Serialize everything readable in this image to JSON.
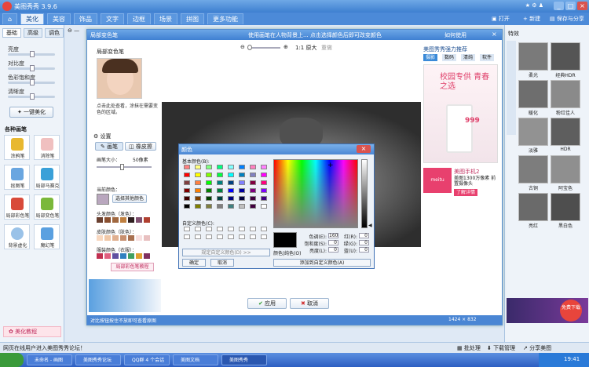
{
  "app": {
    "title": "美图秀秀 3.9.6",
    "open_label": "打开",
    "new_label": "新建",
    "save_label": "保存与分享"
  },
  "tabs": [
    {
      "label": "美化"
    },
    {
      "label": "美容"
    },
    {
      "label": "饰品"
    },
    {
      "label": "文字"
    },
    {
      "label": "边框"
    },
    {
      "label": "场景"
    },
    {
      "label": "拼图"
    },
    {
      "label": "更多功能"
    }
  ],
  "left": {
    "subtabs": [
      "基础",
      "高级",
      "调色"
    ],
    "sliders": [
      "亮度",
      "对比度",
      "色彩饱和度",
      "清晰度"
    ],
    "one_click": "一键美化",
    "section_title": "各种画笔",
    "tools": [
      "涂鸦笔",
      "消除笔",
      "抠图笔",
      "局部马赛克",
      "局部彩色笔",
      "局部变色笔",
      "背景虚化",
      "魔幻笔"
    ],
    "bottom_label": "美化教程"
  },
  "editor": {
    "title": "局部变色笔",
    "header_center": "使用画笔在人物背景上... 点击选择颜色后即可改变颜色",
    "header_right": "如何使用",
    "zoom_label": "1:1 原大",
    "reset_label": "重做",
    "sample_caption": "局部变色笔",
    "instructions": "点击此处查看，涂抹在需要变色的区域。",
    "settings_title": "设置",
    "mode_paint": "画笔",
    "mode_erase": "橡皮擦",
    "brush_size_label": "画笔大小：",
    "brush_size_value": "50像素",
    "current_color_label": "当前颜色：",
    "choose_color_btn": "选择其他颜色",
    "hair_label": "头发颜色（发色）：",
    "skin_label": "皮肤颜色（肤色）：",
    "clothes_label": "服装颜色（衣服）：",
    "tutorial_btn": "局部彩色笔教程",
    "ok_btn": "应用",
    "cancel_btn": "取消",
    "footer_text": "对比按钮按住不放即可查看原图",
    "dimensions": "1424 × 832"
  },
  "color_dialog": {
    "title": "颜色",
    "basic_label": "基本颜色(B):",
    "custom_label": "自定义颜色(C):",
    "define_btn": "规定自定义颜色(D) >>",
    "ok_btn": "确定",
    "cancel_btn": "取消",
    "add_btn": "添加到自定义颜色(A)",
    "color_solid_label": "颜色|纯色(O)",
    "hue_label": "色调(E):",
    "hue_value": "160",
    "sat_label": "饱和度(S):",
    "sat_value": "0",
    "lum_label": "亮度(L):",
    "lum_value": "0",
    "red_label": "红(R):",
    "red_value": "0",
    "green_label": "绿(G):",
    "green_value": "0",
    "blue_label": "蓝(U):",
    "blue_value": "0",
    "basic_colors": [
      "#ff8080",
      "#ffff80",
      "#80ff80",
      "#00ff80",
      "#80ffff",
      "#0080ff",
      "#ff80c0",
      "#ff80ff",
      "#ff0000",
      "#ffff00",
      "#80ff00",
      "#00ff40",
      "#00ffff",
      "#0080c0",
      "#8080c0",
      "#ff00ff",
      "#804040",
      "#ff8040",
      "#00ff00",
      "#008080",
      "#004080",
      "#8080ff",
      "#800040",
      "#ff0080",
      "#800000",
      "#ff8000",
      "#008000",
      "#008040",
      "#0000ff",
      "#0000a0",
      "#800080",
      "#8000ff",
      "#400000",
      "#804000",
      "#004000",
      "#004040",
      "#000080",
      "#000040",
      "#400040",
      "#400080",
      "#000000",
      "#808000",
      "#808040",
      "#808080",
      "#408080",
      "#c0c0c0",
      "#400040",
      "#ffffff"
    ]
  },
  "promo": {
    "title": "美图秀秀强力推荐",
    "tabs": [
      "摄影",
      "数码",
      "清纯",
      "软件"
    ],
    "ad_headline": "校园专供 青春之选",
    "ad_price": "999",
    "phone_title": "美图手机2",
    "phone_desc": "美图1300万像素 前置摄像头",
    "phone_btn": "了解详情"
  },
  "effects": {
    "title": "特效",
    "items": [
      "柔光",
      "经典HDR",
      "暖化",
      "粉红佳人",
      "淡雅",
      "HDR",
      "古铜",
      "阿宝色",
      "亮红",
      "黑白色"
    ],
    "free_label": "免费下载"
  },
  "status": {
    "left": "网页在线用户进入美图秀秀论坛！",
    "batch": "批处理",
    "download": "下载管理",
    "share": "分享美图"
  },
  "taskbar": {
    "tasks": [
      "未命名 - 画图",
      "美图秀秀论坛",
      "QQ群 4 个会话",
      "美图文档",
      "美图秀秀"
    ],
    "time": "19:41"
  }
}
